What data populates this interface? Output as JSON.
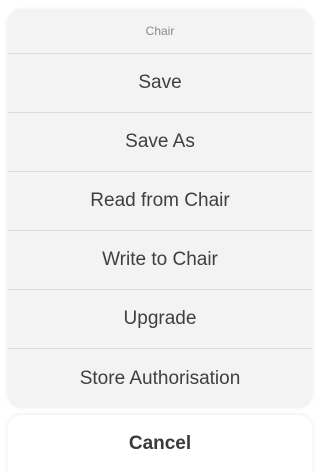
{
  "action_sheet": {
    "title": "Chair",
    "items": [
      {
        "label": "Save"
      },
      {
        "label": "Save As"
      },
      {
        "label": "Read from Chair"
      },
      {
        "label": "Write to Chair"
      },
      {
        "label": "Upgrade"
      },
      {
        "label": "Store Authorisation"
      }
    ],
    "cancel_label": "Cancel"
  }
}
